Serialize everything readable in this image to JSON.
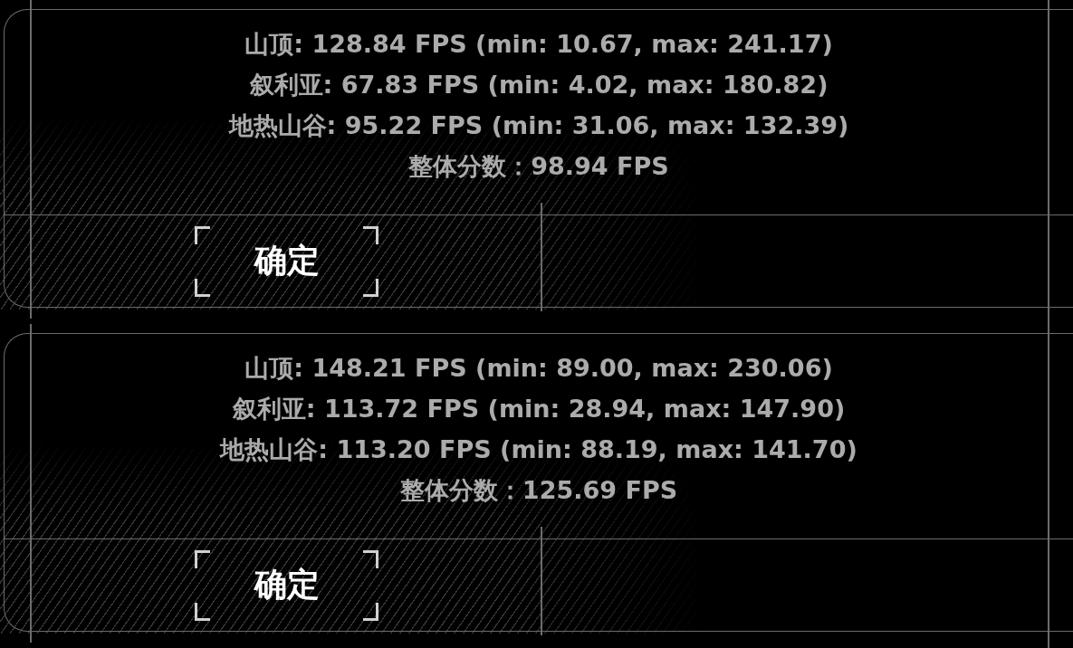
{
  "dialogs": [
    {
      "results": [
        "山顶: 128.84 FPS (min: 10.67, max: 241.17)",
        "叙利亚: 67.83 FPS (min: 4.02, max: 180.82)",
        "地热山谷: 95.22 FPS (min: 31.06, max: 132.39)"
      ],
      "overall_score": "整体分数：98.94 FPS",
      "confirm_button": "确定"
    },
    {
      "results": [
        "山顶: 148.21 FPS (min: 89.00, max: 230.06)",
        "叙利亚: 113.72 FPS (min: 28.94, max: 147.90)",
        "地热山谷: 113.20 FPS (min: 88.19, max: 141.70)"
      ],
      "overall_score": "整体分数：125.69 FPS",
      "confirm_button": "确定"
    }
  ]
}
